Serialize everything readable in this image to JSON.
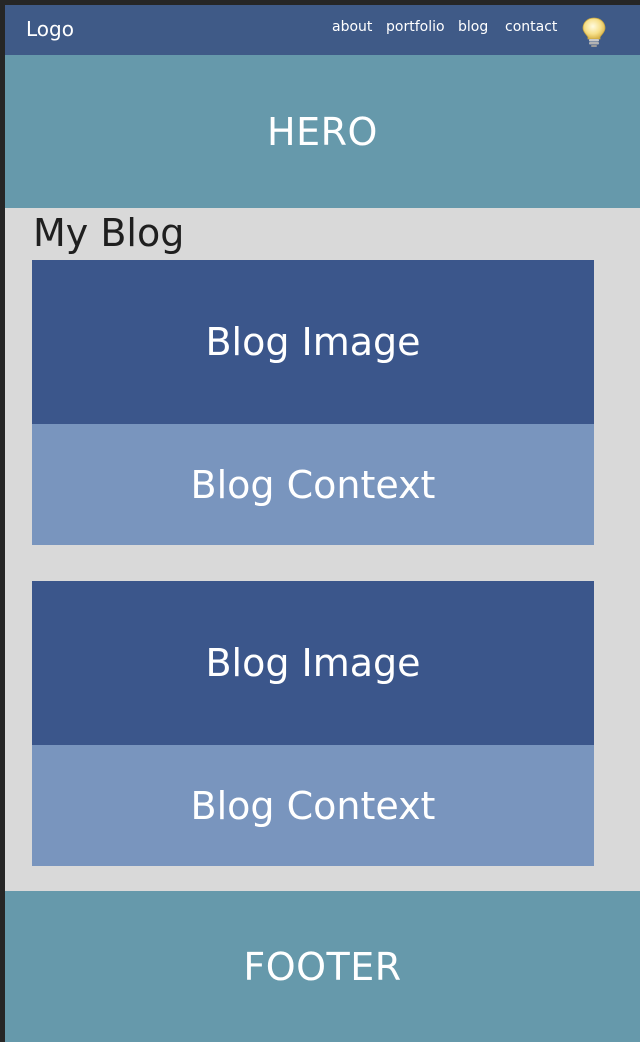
{
  "nav": {
    "logo": "Logo",
    "links": [
      "about",
      "portfolio",
      "blog",
      "contact"
    ],
    "theme_toggle_icon": "lightbulb-icon"
  },
  "hero": {
    "title": "HERO"
  },
  "blog": {
    "heading": "My Blog",
    "cards": [
      {
        "image_label": "Blog Image",
        "context_label": "Blog Context"
      },
      {
        "image_label": "Blog Image",
        "context_label": "Blog Context"
      }
    ]
  },
  "footer": {
    "title": "FOOTER"
  },
  "colors": {
    "navbar": "#3f5a87",
    "hero_footer": "#6699ab",
    "card_image": "#3b568b",
    "card_context": "#7995be",
    "page_background": "#d9d9d9"
  }
}
